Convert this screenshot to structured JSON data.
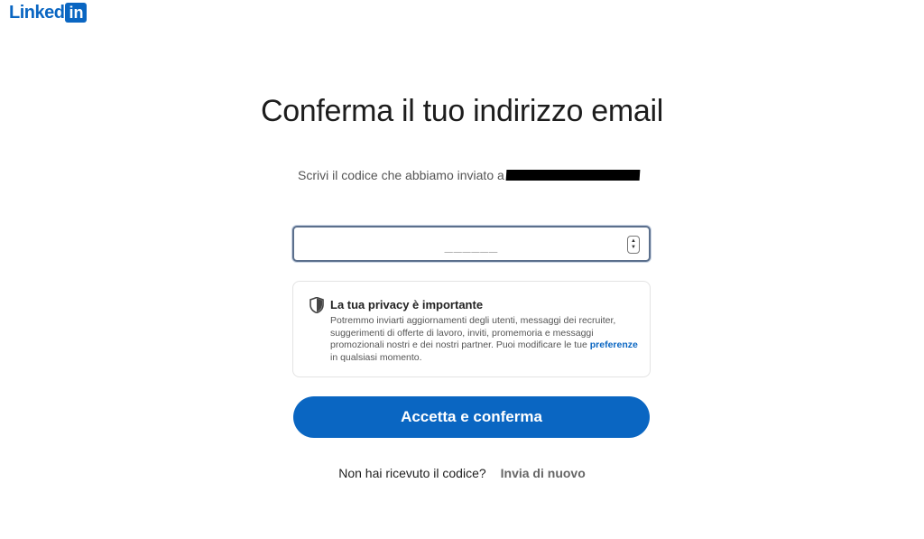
{
  "brand": {
    "logo_text": "Linked",
    "logo_box": "in",
    "color": "#0a66c2"
  },
  "page": {
    "title": "Conferma il tuo indirizzo email"
  },
  "subtitle": {
    "text": "Scrivi il codice che abbiamo inviato a"
  },
  "code_input": {
    "value": "",
    "placeholder": "______"
  },
  "privacy": {
    "icon": "shield-icon",
    "title": "La tua privacy è importante",
    "body_before": "Potremmo inviarti aggiornamenti degli utenti, messaggi dei recruiter, suggerimenti di offerte di lavoro, inviti, promemoria e messaggi promozionali nostri e dei nostri partner. Puoi modificare le tue",
    "link": "preferenze",
    "body_after": "in qualsiasi momento."
  },
  "actions": {
    "accept_label": "Accetta e conferma"
  },
  "resend": {
    "question": "Non hai ricevuto il codice?",
    "link": "Invia di nuovo"
  }
}
